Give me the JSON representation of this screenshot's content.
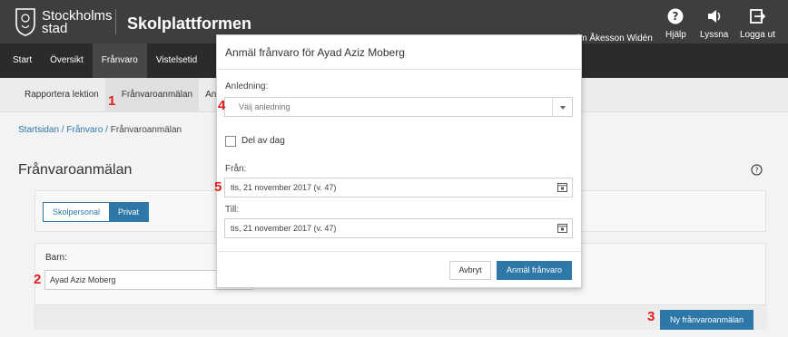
{
  "header": {
    "brand_line1": "Stockholms",
    "brand_line2": "stad",
    "product": "Skolplattformen",
    "user_name": "im Åkesson Widén",
    "actions": [
      {
        "label": "Hjälp",
        "icon": "help-icon"
      },
      {
        "label": "Lyssna",
        "icon": "speaker-icon"
      },
      {
        "label": "Logga ut",
        "icon": "logout-icon"
      }
    ]
  },
  "mainnav": {
    "items": [
      "Start",
      "Översikt",
      "Frånvaro",
      "Vistelsetid"
    ],
    "active": "Frånvaro"
  },
  "subnav": {
    "items": [
      "Rapportera lektion",
      "Frånvaroanmälan",
      "An"
    ],
    "active": "Frånvaroanmälan"
  },
  "breadcrumb": {
    "items": [
      "Startsidan",
      "Frånvaro",
      "Frånvaroanmälan"
    ],
    "separator": " / "
  },
  "page": {
    "title": "Frånvaroanmälan",
    "tabs": [
      "Skolpersonal",
      "Privat"
    ],
    "active_tab": "Privat",
    "barn_label": "Barn:",
    "barn_value": "Ayad Aziz Moberg",
    "new_button": "Ny frånvaroanmälan"
  },
  "modal": {
    "title": "Anmäl frånvaro för Ayad Aziz Moberg",
    "reason_label": "Anledning:",
    "reason_placeholder": "Välj anledning",
    "partial_day_label": "Del av dag",
    "from_label": "Från:",
    "from_value": "tis, 21 november 2017 (v. 47)",
    "to_label": "Till:",
    "to_value": "tis, 21 november 2017 (v. 47)",
    "cancel": "Avbryt",
    "submit": "Anmäl frånvaro"
  },
  "annotations": [
    "1",
    "2",
    "3",
    "4",
    "5"
  ],
  "colors": {
    "accent": "#2d78a8",
    "header_bg": "#3e3e3e",
    "nav_bg": "#2b2b2b",
    "annotation": "#e51b1b"
  }
}
